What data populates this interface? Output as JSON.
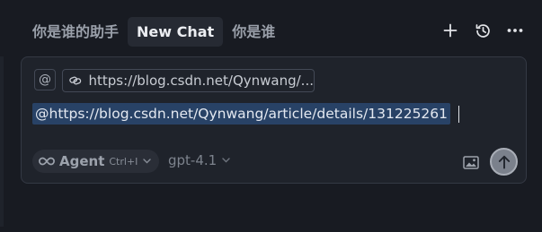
{
  "header": {
    "tabs": [
      {
        "label": "你是谁的助手",
        "active": false
      },
      {
        "label": "New Chat",
        "active": true
      },
      {
        "label": "你是谁",
        "active": false
      }
    ],
    "actions": [
      {
        "icon": "plus-icon"
      },
      {
        "icon": "history-icon"
      },
      {
        "icon": "more-icon"
      }
    ]
  },
  "composer": {
    "at_label": "@",
    "context_pill": {
      "icon": "link-icon",
      "text": "https://blog.csdn.net/Qynwang/..."
    },
    "input_value": "@https://blog.csdn.net/Qynwang/article/details/131225261",
    "agent": {
      "icon": "infinity-icon",
      "label": "Agent",
      "shortcut": "Ctrl+I"
    },
    "model": {
      "label": "gpt-4.1"
    },
    "image_icon": "image-icon",
    "send_icon": "arrow-up-icon"
  },
  "colors": {
    "background": "#181b22",
    "panel": "#1f232b",
    "mention_highlight": "#284266",
    "send_button": "#7b818c"
  }
}
